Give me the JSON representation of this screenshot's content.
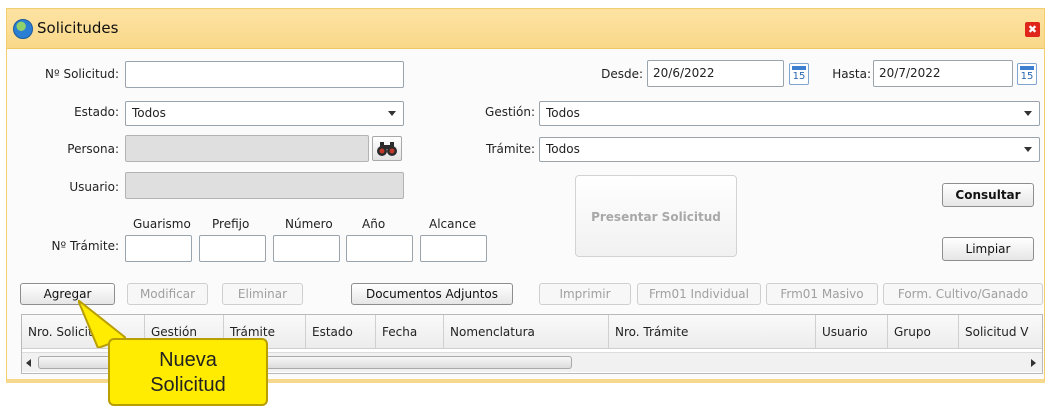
{
  "window": {
    "title": "Solicitudes",
    "close_symbol": "✖"
  },
  "filters": {
    "nro_solicitud_label": "Nº Solicitud:",
    "nro_solicitud_value": "",
    "desde_label": "Desde:",
    "desde_value": "20/6/2022",
    "hasta_label": "Hasta:",
    "hasta_value": "20/7/2022",
    "calendar_day": "15",
    "estado_label": "Estado:",
    "estado_value": "Todos",
    "gestion_label": "Gestión:",
    "gestion_value": "Todos",
    "persona_label": "Persona:",
    "persona_value": "",
    "tramite_label": "Trámite:",
    "tramite_value": "Todos",
    "usuario_label": "Usuario:",
    "usuario_value": "",
    "nro_tramite_label": "Nº Trámite:",
    "tramite_parts": [
      "Guarismo",
      "Prefijo",
      "Número",
      "Año",
      "Alcance"
    ]
  },
  "actions": {
    "present": "Presentar Solicitud",
    "consultar": "Consultar",
    "limpiar": "Limpiar"
  },
  "toolbar": {
    "agregar": "Agregar",
    "modificar": "Modificar",
    "eliminar": "Eliminar",
    "documentos": "Documentos Adjuntos",
    "imprimir": "Imprimir",
    "frm01_individual": "Frm01 Individual",
    "frm01_masivo": "Frm01 Masivo",
    "form_cultivo": "Form. Cultivo/Ganado"
  },
  "grid": {
    "columns": [
      "Nro. Solicitud",
      "Gestión",
      "Trámite",
      "Estado",
      "Fecha",
      "Nomenclatura",
      "Nro. Trámite",
      "Usuario",
      "Grupo",
      "Solicitud V"
    ]
  },
  "tooltip": {
    "line1": "Nueva",
    "line2": "Solicitud"
  },
  "colors": {
    "title_bar": "#fde3a3",
    "tooltip": "#ffec00",
    "close": "#e0251b"
  }
}
